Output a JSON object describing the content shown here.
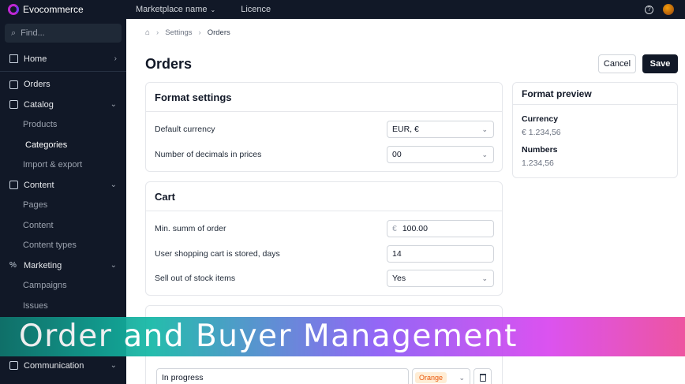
{
  "topbar": {
    "brand": "Evocommerce",
    "nav": [
      {
        "label": "Marketplace name",
        "dropdown": true
      },
      {
        "label": "Licence",
        "dropdown": false
      }
    ],
    "help_icon": "?"
  },
  "sidebar": {
    "search_placeholder": "Find...",
    "items": [
      {
        "label": "Home",
        "icon": "home-icon"
      },
      {
        "label": "Orders",
        "icon": "cart-icon"
      },
      {
        "label": "Catalog",
        "icon": "catalog-icon"
      },
      {
        "label": "Products"
      },
      {
        "label": "Categories"
      },
      {
        "label": "Import & export"
      },
      {
        "label": "Content",
        "icon": "content-icon"
      },
      {
        "label": "Pages"
      },
      {
        "label": "Content"
      },
      {
        "label": "Content types"
      },
      {
        "label": "Marketing",
        "icon": "percent-icon"
      },
      {
        "label": "Campaigns"
      },
      {
        "label": "Issues"
      },
      {
        "label": "Communication",
        "icon": "chat-icon"
      }
    ]
  },
  "breadcrumb": {
    "home_icon": "home-icon",
    "items": [
      "Settings",
      "Orders"
    ]
  },
  "page": {
    "title": "Orders",
    "cancel_label": "Cancel",
    "save_label": "Save"
  },
  "format_settings": {
    "title": "Format settings",
    "rows": [
      {
        "label": "Default currency",
        "value": "EUR, €"
      },
      {
        "label": "Number of decimals in prices",
        "value": "00"
      }
    ]
  },
  "cart": {
    "title": "Cart",
    "rows": [
      {
        "label": "Min. summ of order",
        "prefix": "€",
        "value": "100.00"
      },
      {
        "label": "User shopping cart is stored, days",
        "value": "14"
      },
      {
        "label": "Sell out of stock items",
        "value": "Yes"
      }
    ]
  },
  "format_preview": {
    "title": "Format preview",
    "currency_label": "Currency",
    "currency_value": "€ 1.234,56",
    "numbers_label": "Numbers",
    "numbers_value": "1.234,56"
  },
  "order_status": {
    "name": "In progress",
    "color": "Orange"
  },
  "banner": {
    "text": "Order and Buyer Management"
  },
  "colors": {
    "accent": "#111827",
    "badge_orange": "#ea580c"
  }
}
